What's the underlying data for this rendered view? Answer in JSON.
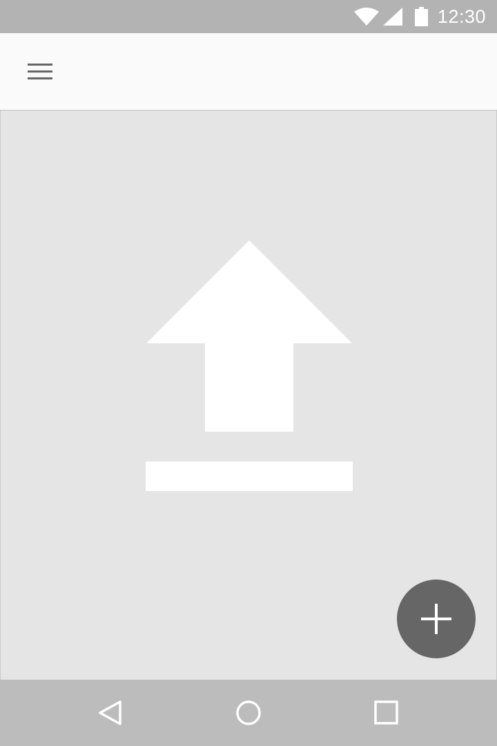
{
  "status_bar": {
    "time": "12:30",
    "icons": [
      "wifi-icon",
      "cellular-signal-icon",
      "battery-icon"
    ]
  },
  "app_bar": {
    "menu_icon": "hamburger-menu-icon"
  },
  "content": {
    "graphic": "upload-icon"
  },
  "fab": {
    "icon": "plus-icon"
  },
  "nav_bar": {
    "buttons": [
      "back-icon",
      "home-icon",
      "recents-icon"
    ]
  },
  "colors": {
    "status_bar_bg": "#b3b3b3",
    "app_bar_bg": "#fafafa",
    "content_bg": "#e5e5e5",
    "fab_bg": "#666666",
    "nav_bar_bg": "#bcbcbc",
    "icon_white": "#ffffff",
    "menu_icon": "#666666"
  }
}
